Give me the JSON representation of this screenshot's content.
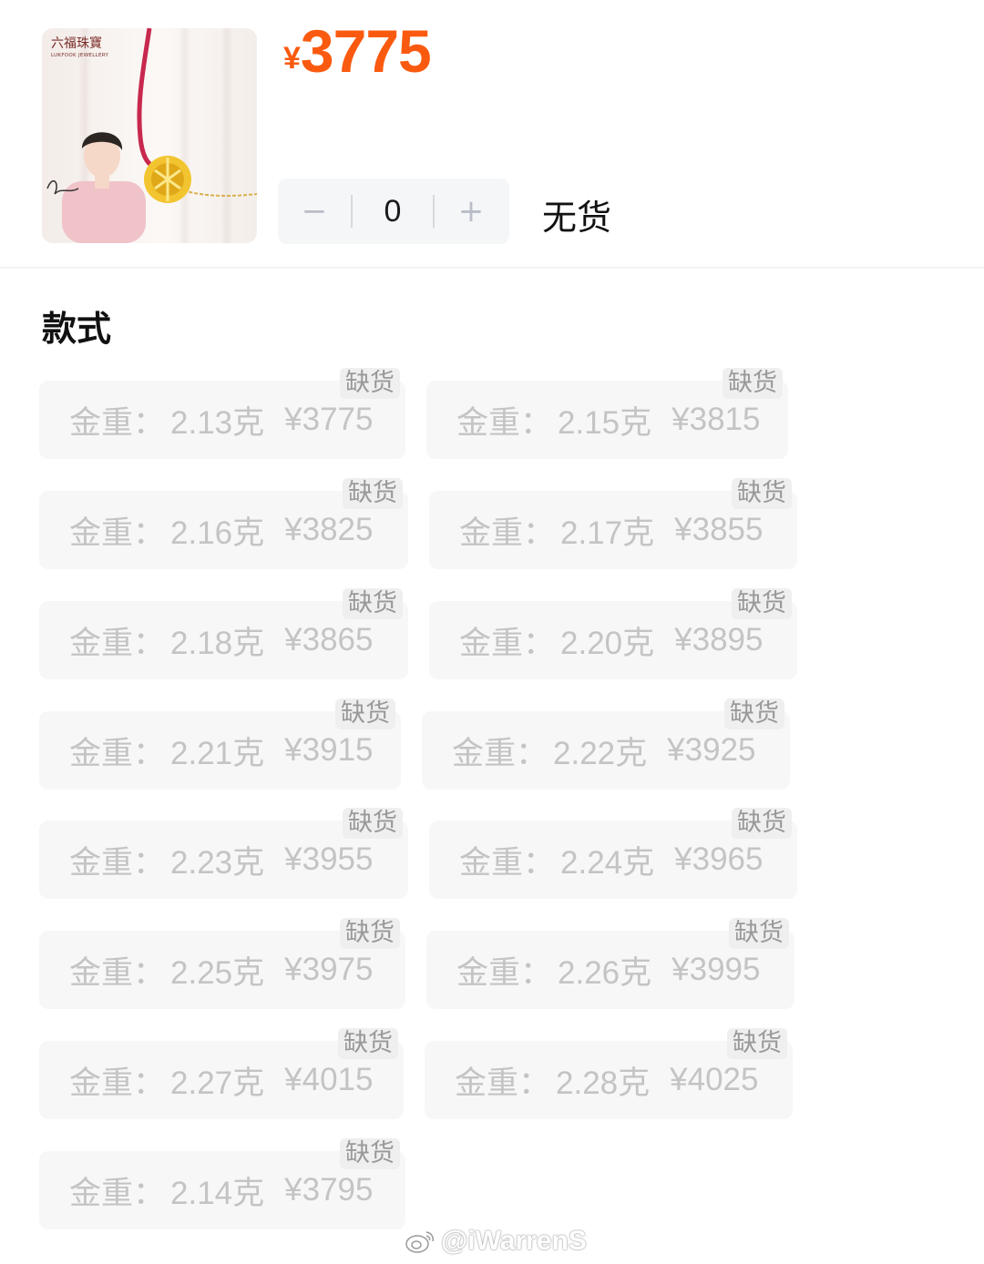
{
  "product": {
    "brand_logo": "六福珠寶",
    "brand_logo_sub": "LUKFOOK JEWELLERY",
    "price_symbol": "¥",
    "price": "3775"
  },
  "quantity": {
    "decrement_label": "−",
    "increment_label": "+",
    "value": "0"
  },
  "stock_status": "无货",
  "section_title": "款式",
  "options": [
    {
      "label": "金重：",
      "weight": "2.13克",
      "price": "¥3775",
      "badge": "缺货"
    },
    {
      "label": "金重：",
      "weight": "2.15克",
      "price": "¥3815",
      "badge": "缺货"
    },
    {
      "label": "金重：",
      "weight": "2.16克",
      "price": "¥3825",
      "badge": "缺货"
    },
    {
      "label": "金重：",
      "weight": "2.17克",
      "price": "¥3855",
      "badge": "缺货"
    },
    {
      "label": "金重：",
      "weight": "2.18克",
      "price": "¥3865",
      "badge": "缺货"
    },
    {
      "label": "金重：",
      "weight": "2.20克",
      "price": "¥3895",
      "badge": "缺货"
    },
    {
      "label": "金重：",
      "weight": "2.21克",
      "price": "¥3915",
      "badge": "缺货"
    },
    {
      "label": "金重：",
      "weight": "2.22克",
      "price": "¥3925",
      "badge": "缺货"
    },
    {
      "label": "金重：",
      "weight": "2.23克",
      "price": "¥3955",
      "badge": "缺货"
    },
    {
      "label": "金重：",
      "weight": "2.24克",
      "price": "¥3965",
      "badge": "缺货"
    },
    {
      "label": "金重：",
      "weight": "2.25克",
      "price": "¥3975",
      "badge": "缺货"
    },
    {
      "label": "金重：",
      "weight": "2.26克",
      "price": "¥3995",
      "badge": "缺货"
    },
    {
      "label": "金重：",
      "weight": "2.27克",
      "price": "¥4015",
      "badge": "缺货"
    },
    {
      "label": "金重：",
      "weight": "2.28克",
      "price": "¥4025",
      "badge": "缺货"
    },
    {
      "label": "金重：",
      "weight": "2.14克",
      "price": "¥3795",
      "badge": "缺货"
    }
  ],
  "watermark": "@iWarrenS",
  "icons": {
    "watermark": "weibo-icon"
  },
  "colors": {
    "price": "#fa5a0f",
    "disabled_text": "#c4c4c4",
    "option_bg": "#f7f7f7"
  }
}
